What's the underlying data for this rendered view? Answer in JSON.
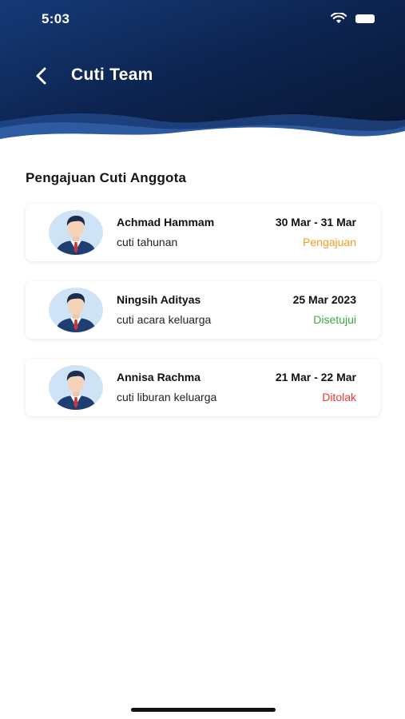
{
  "status_bar": {
    "time": "5:03"
  },
  "header": {
    "title": "Cuti Team"
  },
  "section": {
    "title": "Pengajuan Cuti Anggota"
  },
  "colors": {
    "header_dark": "#0d2552",
    "status_pending": "#f29d1b",
    "status_approved": "#3aa84a",
    "status_rejected": "#e53935"
  },
  "leave_requests": [
    {
      "name": "Achmad Hammam",
      "reason": "cuti tahunan",
      "date": "30 Mar - 31 Mar",
      "status": "Pengajuan"
    },
    {
      "name": "Ningsih Adityas",
      "reason": "cuti acara keluarga",
      "date": "25 Mar 2023",
      "status": "Disetujui"
    },
    {
      "name": "Annisa Rachma",
      "reason": "cuti liburan keluarga",
      "date": "21 Mar - 22 Mar",
      "status": "Ditolak"
    }
  ]
}
